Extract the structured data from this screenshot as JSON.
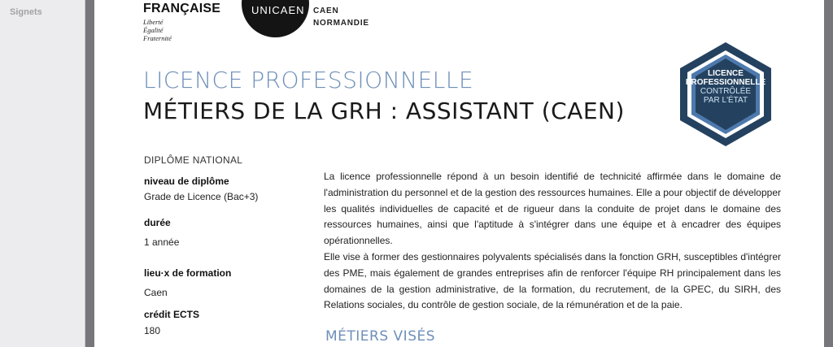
{
  "sidebar": {
    "title": "Signets"
  },
  "header": {
    "rf_name": "FRANÇAISE",
    "rf_motto": [
      "Liberté",
      "Égalité",
      "Fraternité"
    ],
    "logo_text": "UNICAEN",
    "caen": "CAEN",
    "normandie": "NORMANDIE"
  },
  "title": {
    "line1": "LICENCE PROFESSIONNELLE",
    "line2": "MÉTIERS DE LA GRH : ASSISTANT (CAEN)"
  },
  "badge": {
    "line1": "LICENCE",
    "line2": "PROFESSIONNELLE",
    "line3": "CONTRÔLÉE",
    "line4": "PAR L'ÉTAT",
    "outer_color": "#24425f",
    "inner_color": "#4d79ad"
  },
  "info": {
    "diplome": "DIPLÔME NATIONAL",
    "niveau_label": "niveau de diplôme",
    "niveau_value": "Grade de Licence (Bac+3)",
    "duree_label": "durée",
    "duree_value": "1 année",
    "lieu_label": "lieu·x de formation",
    "lieu_value": "Caen",
    "credit_label": "crédit ECTS",
    "credit_value": "180"
  },
  "description": {
    "p1": "La licence professionnelle répond à un besoin identifié de technicité affirmée dans le domaine de l'administration du personnel et de la gestion des ressources humaines. Elle a pour objectif de développer les qualités individuelles de capacité et de rigueur dans la conduite de projet dans le domaine des ressources humaines, ainsi que l'aptitude à s'intégrer dans une équipe et à encadrer des équipes opérationnelles.",
    "p2": "Elle vise à former des gestionnaires polyvalents spécialisés dans la fonction GRH, susceptibles d'intégrer des PME, mais également de grandes entreprises afin de renforcer l'équipe RH principalement dans les domaines de la gestion administrative, de la formation, du recrutement, de la GPEC, du SIRH, des Relations sociales, du contrôle de gestion sociale, de la rémunération et de la paie."
  },
  "section": {
    "metiers": "MÉTIERS VISÉS"
  },
  "colors": {
    "accent": "#6f8fb9",
    "viewer_bg": "#77777b"
  }
}
